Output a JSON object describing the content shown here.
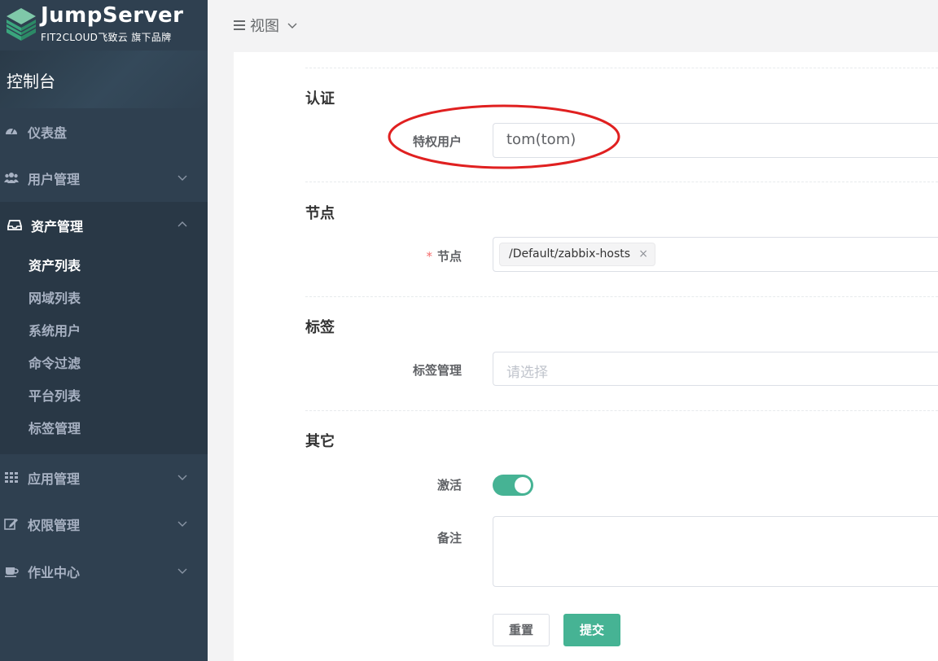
{
  "brand": {
    "name": "JumpServer",
    "tagline": "FIT2CLOUD飞致云 旗下品牌"
  },
  "sidebar": {
    "console": "控制台",
    "items": [
      {
        "label": "仪表盘",
        "icon": "dashboard-icon"
      },
      {
        "label": "用户管理",
        "icon": "users-icon"
      },
      {
        "label": "资产管理",
        "icon": "inbox-icon"
      },
      {
        "label": "应用管理",
        "icon": "grid-icon"
      },
      {
        "label": "权限管理",
        "icon": "edit-icon"
      },
      {
        "label": "作业中心",
        "icon": "coffee-icon"
      }
    ],
    "asset_submenu": [
      "资产列表",
      "网域列表",
      "系统用户",
      "命令过滤",
      "平台列表",
      "标签管理"
    ]
  },
  "topbar": {
    "view_label": "视图"
  },
  "form": {
    "sections": {
      "auth": "认证",
      "nodes": "节点",
      "labels": "标签",
      "other": "其它"
    },
    "fields": {
      "privileged_user_label": "特权用户",
      "privileged_user_value": "tom(tom)",
      "node_label": "节点",
      "node_required_mark": "*",
      "node_tag": "/Default/zabbix-hosts",
      "node_tag_close": "×",
      "label_mgmt_label": "标签管理",
      "label_mgmt_placeholder": "请选择",
      "active_label": "激活",
      "active_value": true,
      "comment_label": "备注"
    },
    "buttons": {
      "reset": "重置",
      "submit": "提交"
    }
  },
  "colors": {
    "sidebar_bg": "#2f4050",
    "accent": "#46b394",
    "annotation": "#e02020"
  }
}
